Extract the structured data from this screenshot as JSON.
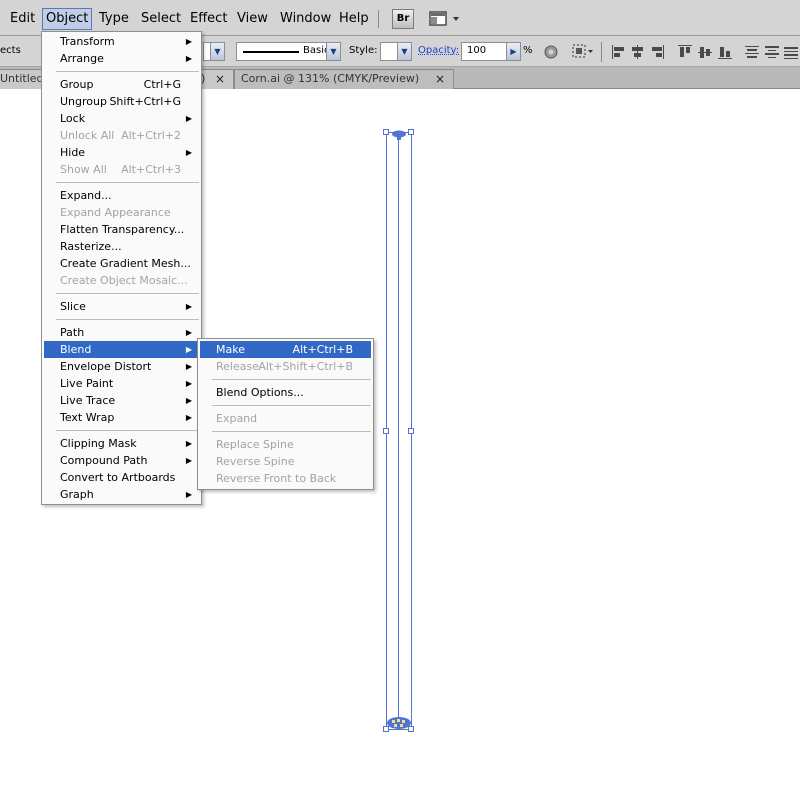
{
  "menubar": {
    "items": [
      "Edit",
      "Object",
      "Type",
      "Select",
      "Effect",
      "View",
      "Window",
      "Help"
    ],
    "active": "Object",
    "bridge_label": "Br"
  },
  "controlbar": {
    "left_cut_label": "ects",
    "stroke_profile": "Basic",
    "style_label": "Style:",
    "opacity_label": "Opacity:",
    "opacity_value": "100",
    "percent": "%"
  },
  "tabs": [
    {
      "label": "Untitled",
      "close": "×"
    },
    {
      "label": ")",
      "close": "×"
    },
    {
      "label": "Corn.ai @ 131% (CMYK/Preview)",
      "close": "×"
    }
  ],
  "object_menu": [
    {
      "label": "Transform",
      "submenu": true
    },
    {
      "label": "Arrange",
      "submenu": true
    },
    {
      "sep": true
    },
    {
      "label": "Group",
      "shortcut": "Ctrl+G"
    },
    {
      "label": "Ungroup",
      "shortcut": "Shift+Ctrl+G"
    },
    {
      "label": "Lock",
      "submenu": true
    },
    {
      "label": "Unlock All",
      "shortcut": "Alt+Ctrl+2",
      "disabled": true
    },
    {
      "label": "Hide",
      "submenu": true
    },
    {
      "label": "Show All",
      "shortcut": "Alt+Ctrl+3",
      "disabled": true
    },
    {
      "sep": true
    },
    {
      "label": "Expand..."
    },
    {
      "label": "Expand Appearance",
      "disabled": true
    },
    {
      "label": "Flatten Transparency..."
    },
    {
      "label": "Rasterize..."
    },
    {
      "label": "Create Gradient Mesh..."
    },
    {
      "label": "Create Object Mosaic...",
      "disabled": true
    },
    {
      "sep": true
    },
    {
      "label": "Slice",
      "submenu": true
    },
    {
      "sep": true
    },
    {
      "label": "Path",
      "submenu": true
    },
    {
      "label": "Blend",
      "submenu": true,
      "highlighted": true
    },
    {
      "label": "Envelope Distort",
      "submenu": true
    },
    {
      "label": "Live Paint",
      "submenu": true
    },
    {
      "label": "Live Trace",
      "submenu": true
    },
    {
      "label": "Text Wrap",
      "submenu": true
    },
    {
      "sep": true
    },
    {
      "label": "Clipping Mask",
      "submenu": true
    },
    {
      "label": "Compound Path",
      "submenu": true
    },
    {
      "label": "Convert to Artboards"
    },
    {
      "label": "Graph",
      "submenu": true
    }
  ],
  "blend_menu": [
    {
      "label": "Make",
      "shortcut": "Alt+Ctrl+B",
      "highlighted": true
    },
    {
      "label": "Release",
      "shortcut": "Alt+Shift+Ctrl+B",
      "disabled": true
    },
    {
      "sep": true
    },
    {
      "label": "Blend Options..."
    },
    {
      "sep": true
    },
    {
      "label": "Expand",
      "disabled": true
    },
    {
      "sep": true
    },
    {
      "label": "Replace Spine",
      "disabled": true
    },
    {
      "label": "Reverse Spine",
      "disabled": true
    },
    {
      "label": "Reverse Front to Back",
      "disabled": true
    }
  ],
  "colors": {
    "highlight": "#3168c5",
    "selection": "#4f74d6",
    "disabled_text": "#a3a3a3"
  }
}
